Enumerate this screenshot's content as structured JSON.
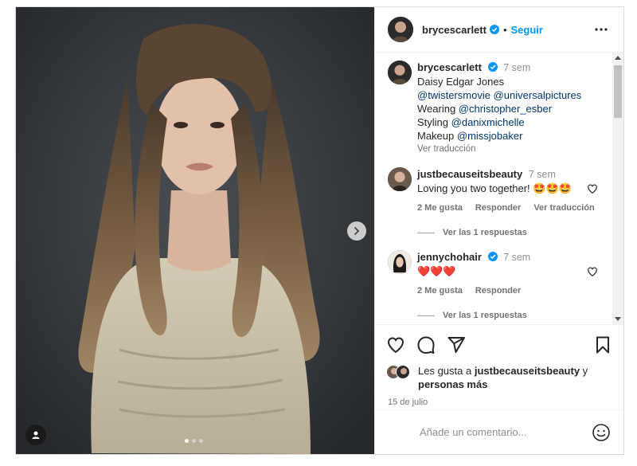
{
  "post": {
    "author": "brycescarlett",
    "separator": "•",
    "follow_label": "Seguir",
    "media": {
      "slide_count": 3,
      "active_slide": 1
    }
  },
  "caption": {
    "username": "brycescarlett",
    "time": "7 sem",
    "lines": [
      {
        "text": "Daisy Edgar Jones",
        "is_link": false
      },
      {
        "text": "@twistersmovie @universalpictures",
        "is_link": true
      },
      {
        "prefix": "Wearing ",
        "text": "@christopher_esber",
        "is_link": true
      },
      {
        "prefix": "Styling ",
        "text": "@danixmichelle",
        "is_link": true
      },
      {
        "prefix": "Makeup ",
        "text": "@missjobaker",
        "is_link": true
      }
    ],
    "translate_label": "Ver traducción"
  },
  "comments": [
    {
      "username": "justbecauseitsbeauty",
      "time": "7 sem",
      "text": "Loving you two together! 🤩🤩🤩",
      "likes": "2 Me gusta",
      "reply_label": "Responder",
      "translate_label": "Ver traducción",
      "replies_label": "Ver las 1 respuestas"
    },
    {
      "username": "jennychohair",
      "time": "7 sem",
      "text": "❤️❤️❤️",
      "likes": "2 Me gusta",
      "reply_label": "Responder",
      "replies_label": "Ver las 1 respuestas"
    }
  ],
  "likes": {
    "prefix": "Les gusta a ",
    "user": "justbecauseitsbeauty",
    "connector": " y",
    "others": "personas más"
  },
  "date": "15 de julio",
  "add_comment": {
    "placeholder": "Añade un comentario..."
  },
  "colors": {
    "accent": "#0095f6",
    "link": "#00376b",
    "muted": "#737373",
    "heart_red": "#ed1c24"
  }
}
